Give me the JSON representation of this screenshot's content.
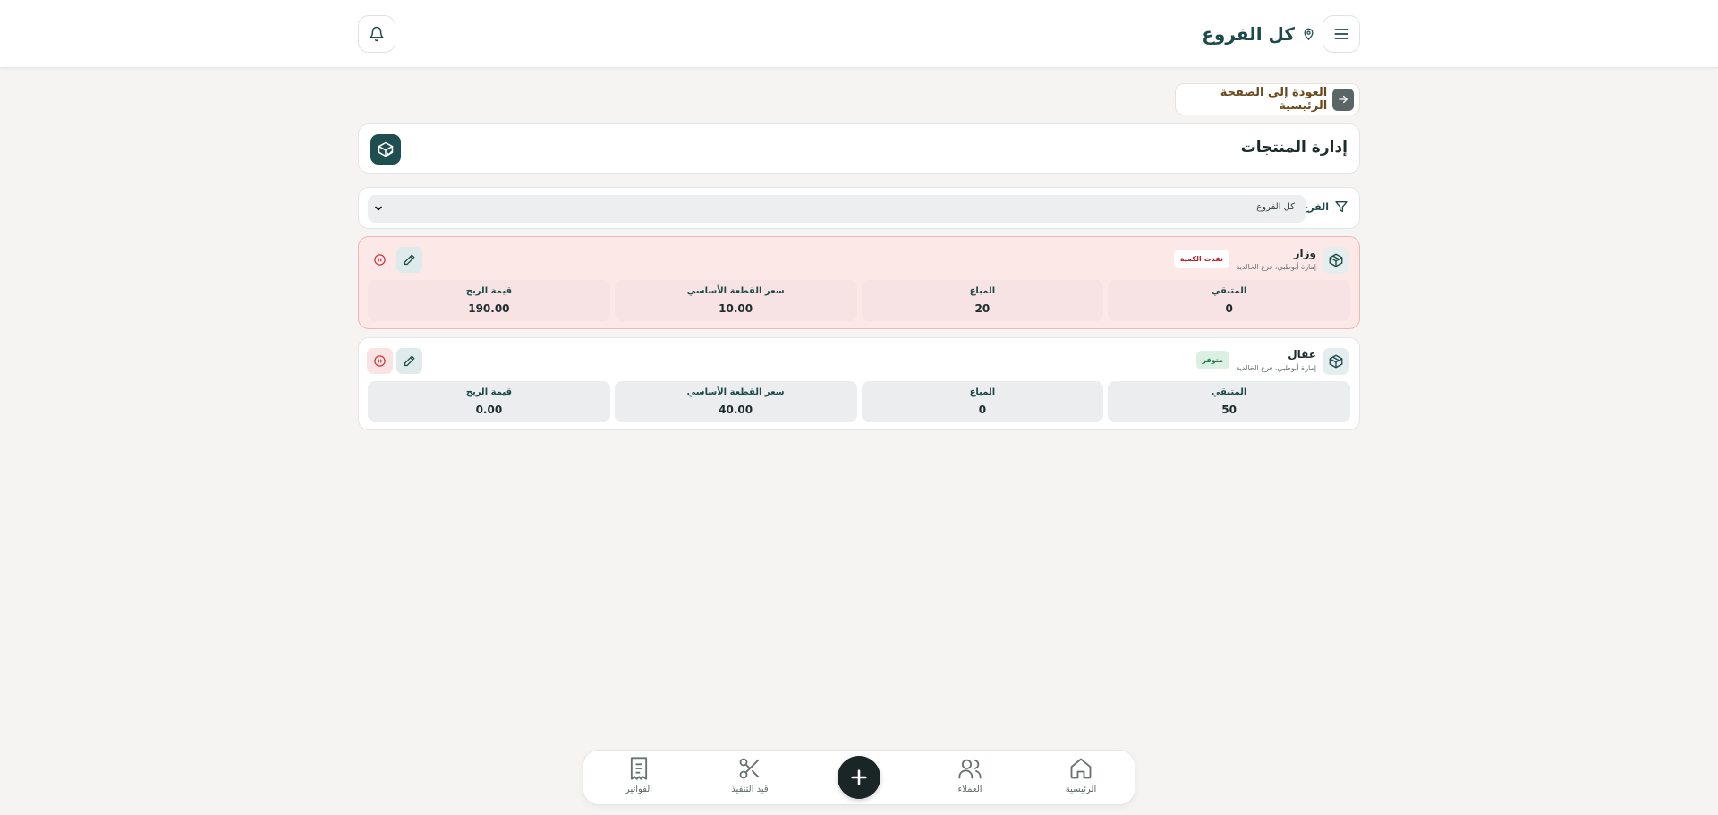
{
  "header": {
    "branch_title": "كل الفروع",
    "icons": {
      "menu": "menu-icon",
      "location": "map-pin-icon",
      "notifications": "bell-icon"
    }
  },
  "back_button": {
    "label": "العودة إلى الصفحة الرئيسية",
    "icon": "arrow-right-icon"
  },
  "page": {
    "title": "إدارة المنتجات",
    "title_icon": "package-check-icon"
  },
  "filter": {
    "label": "الفرع",
    "icon": "filter-icon",
    "selected": "كل الفروع"
  },
  "products": [
    {
      "name": "وزار",
      "branch": "إمارة أبوظبي، فرع الخالدية",
      "status": "نفدت الكمية",
      "status_type": "out",
      "stats": [
        {
          "label": "المتبقي",
          "value": "0"
        },
        {
          "label": "المباع",
          "value": "20"
        },
        {
          "label": "سعر القطعة الأساسي",
          "value": "10.00"
        },
        {
          "label": "قيمة الربح",
          "value": "190.00"
        }
      ]
    },
    {
      "name": "عقال",
      "branch": "إمارة أبوظبي، فرع الخالدية",
      "status": "متوفر",
      "status_type": "in",
      "stats": [
        {
          "label": "المتبقي",
          "value": "50"
        },
        {
          "label": "المباع",
          "value": "0"
        },
        {
          "label": "سعر القطعة الأساسي",
          "value": "40.00"
        },
        {
          "label": "قيمة الربح",
          "value": "0.00"
        }
      ]
    }
  ],
  "bottom_nav": {
    "home": "الرئيسية",
    "customers": "العملاء",
    "in_progress": "قيد التنفيذ",
    "invoices": "الفواتير"
  },
  "colors": {
    "brand": "#1f4e50",
    "out_of_stock_bg": "#fde8e8",
    "in_stock_badge": "#dcefe3",
    "fab": "#1a2525"
  }
}
